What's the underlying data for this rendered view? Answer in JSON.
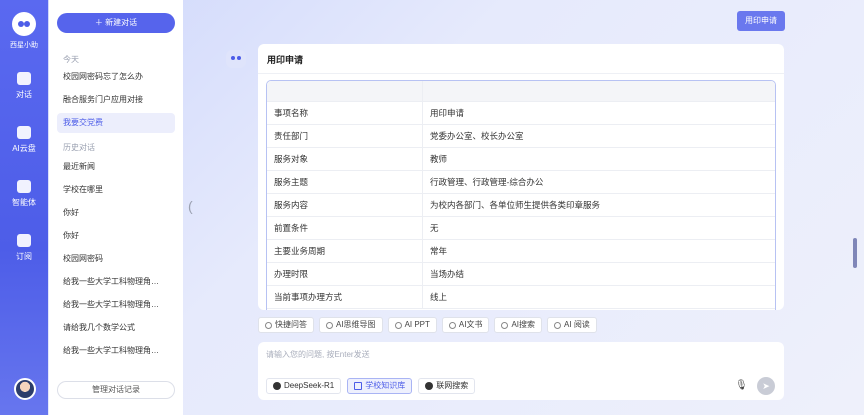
{
  "rail": {
    "app_name": "西星小助",
    "items": [
      {
        "label": "对话",
        "icon": "chat-icon"
      },
      {
        "label": "AI云盘",
        "icon": "cloud-disk-icon"
      },
      {
        "label": "智能体",
        "icon": "agent-grid-icon"
      },
      {
        "label": "订阅",
        "icon": "bookmark-icon"
      }
    ]
  },
  "sidebar": {
    "new_chat": "＋ 新建对话",
    "today_label": "今天",
    "today": [
      "校园网密码忘了怎么办",
      "融合服务门户应用对接",
      "我要交党费"
    ],
    "history_label": "历史对话",
    "history": [
      "最近新闻",
      "学校在哪里",
      "你好",
      "你好",
      "校园网密码",
      "给我一些大学工科物理角…",
      "给我一些大学工科物理角…",
      "请给我几个数学公式",
      "给我一些大学工科物理角…"
    ],
    "manage": "管理对话记录"
  },
  "header": {
    "apply_button": "用印申请"
  },
  "card": {
    "title": "用印申请",
    "rows": [
      {
        "k": "事项名称",
        "v": "用印申请"
      },
      {
        "k": "责任部门",
        "v": "党委办公室、校长办公室"
      },
      {
        "k": "服务对象",
        "v": "教师"
      },
      {
        "k": "服务主题",
        "v": "行政管理、行政管理-综合办公"
      },
      {
        "k": "服务内容",
        "v": "为校内各部门、各单位师生提供各类印章服务"
      },
      {
        "k": "前置条件",
        "v": "无"
      },
      {
        "k": "主要业务周期",
        "v": "常年"
      },
      {
        "k": "办理时限",
        "v": "当场办结"
      },
      {
        "k": "当前事项办理方式",
        "v": "线上"
      }
    ]
  },
  "tools": [
    "快捷问答",
    "AI思维导图",
    "AI PPT",
    "AI文书",
    "AI搜索",
    "AI 阅读"
  ],
  "input": {
    "placeholder": "请输入您的问题, 按Enter发送",
    "chips": [
      {
        "label": "DeepSeek-R1",
        "selected": false
      },
      {
        "label": "学校知识库",
        "selected": true
      },
      {
        "label": "联网搜索",
        "selected": false
      }
    ],
    "send": "➤"
  },
  "colors": {
    "accent": "#4d5de8",
    "rail": "#5a69f0"
  }
}
